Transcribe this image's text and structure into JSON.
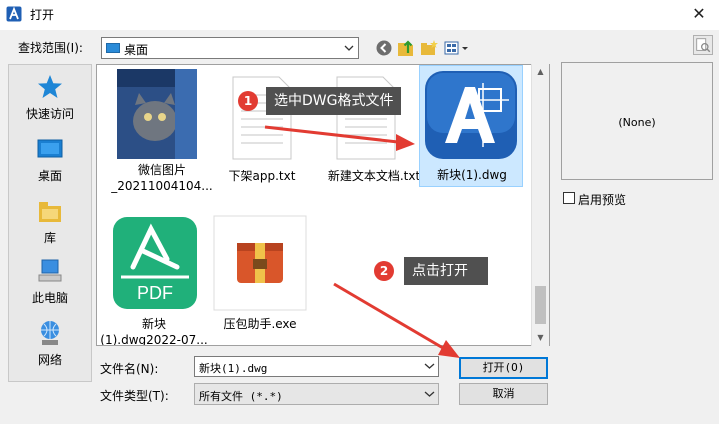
{
  "window": {
    "title": "打开",
    "close_glyph": "✕"
  },
  "lookin": {
    "label": "查找范围(I):",
    "value": "桌面"
  },
  "toolbar": {
    "icons": [
      "back-icon",
      "up-folder-icon",
      "new-folder-icon",
      "view-menu-icon"
    ]
  },
  "places": [
    {
      "label": "快速访问",
      "icon": "star-icon"
    },
    {
      "label": "桌面",
      "icon": "desktop-icon"
    },
    {
      "label": "库",
      "icon": "library-icon"
    },
    {
      "label": "此电脑",
      "icon": "computer-icon"
    },
    {
      "label": "网络",
      "icon": "network-icon"
    }
  ],
  "files": [
    {
      "name_line1": "微信图片",
      "name_line2": "_20211004104...",
      "kind": "image"
    },
    {
      "name_line1": "下架app.txt",
      "name_line2": "",
      "kind": "txt"
    },
    {
      "name_line1": "新建文本文档.txt",
      "name_line2": "",
      "kind": "txt"
    },
    {
      "name_line1": "新块(1).dwg",
      "name_line2": "",
      "kind": "dwg"
    },
    {
      "name_line1": "新块",
      "name_line2": "(1).dwg2022-07...",
      "kind": "pdf",
      "thumb_text": "PDF"
    },
    {
      "name_line1": "压包助手.exe",
      "name_line2": "",
      "kind": "exe"
    }
  ],
  "annotations": {
    "step1": {
      "badge": "1",
      "text": "选中DWG格式文件"
    },
    "step2": {
      "badge": "2",
      "text": "点击打开"
    }
  },
  "filename": {
    "label": "文件名(N):",
    "value": "新块(1).dwg"
  },
  "filetype": {
    "label": "文件类型(T):",
    "value": "所有文件 (*.*)"
  },
  "buttons": {
    "open": "打开(O)",
    "cancel": "取消"
  },
  "preview": {
    "none_text": "(None)",
    "checkbox_label": "启用预览"
  },
  "colors": {
    "dwg_blue": "#1f5fb4",
    "pdf_green": "#20b07a",
    "annotation_red": "#e23b32",
    "tooltip_bg": "#505050"
  }
}
